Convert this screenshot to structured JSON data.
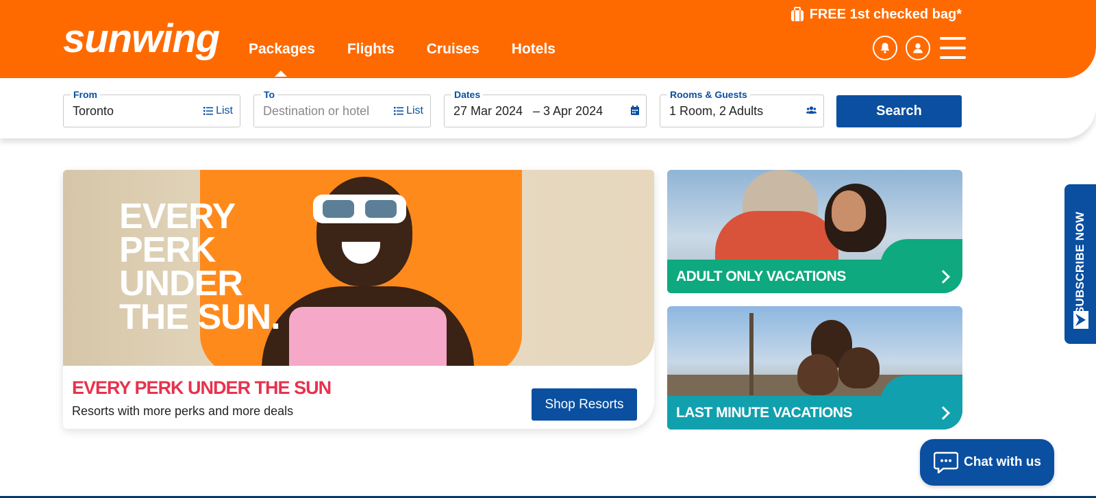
{
  "header": {
    "logo": "sunwing",
    "promo_text": "FREE 1st checked bag*",
    "nav": [
      {
        "label": "Packages",
        "active": true
      },
      {
        "label": "Flights",
        "active": false
      },
      {
        "label": "Cruises",
        "active": false
      },
      {
        "label": "Hotels",
        "active": false
      }
    ],
    "icons": [
      "bell-icon",
      "user-icon",
      "hamburger-menu-icon"
    ]
  },
  "search": {
    "from": {
      "label": "From",
      "value": "Toronto",
      "action": "List"
    },
    "to": {
      "label": "To",
      "placeholder": "Destination or hotel",
      "action": "List"
    },
    "dates": {
      "label": "Dates",
      "start": "27 Mar 2024",
      "end": "– 3 Apr 2024"
    },
    "rooms": {
      "label": "Rooms & Guests",
      "value": "1 Room, 2 Adults"
    },
    "button": "Search"
  },
  "hero": {
    "image_text": "EVERY\nPERK\nUNDER\nTHE SUN.",
    "title": "EVERY PERK UNDER THE SUN",
    "subtitle": "Resorts with more perks and more deals",
    "button": "Shop Resorts"
  },
  "promos": [
    {
      "label": "ADULT ONLY VACATIONS",
      "color": "#0ea97e"
    },
    {
      "label": "LAST MINUTE VACATIONS",
      "color": "#11a0ae"
    }
  ],
  "subscribe": {
    "label": "SUBSCRIBE NOW"
  },
  "chat": {
    "label": "Chat with us"
  },
  "colors": {
    "brand_orange": "#ff6a00",
    "brand_blue": "#0a4fa0",
    "accent_red": "#e8324d"
  }
}
